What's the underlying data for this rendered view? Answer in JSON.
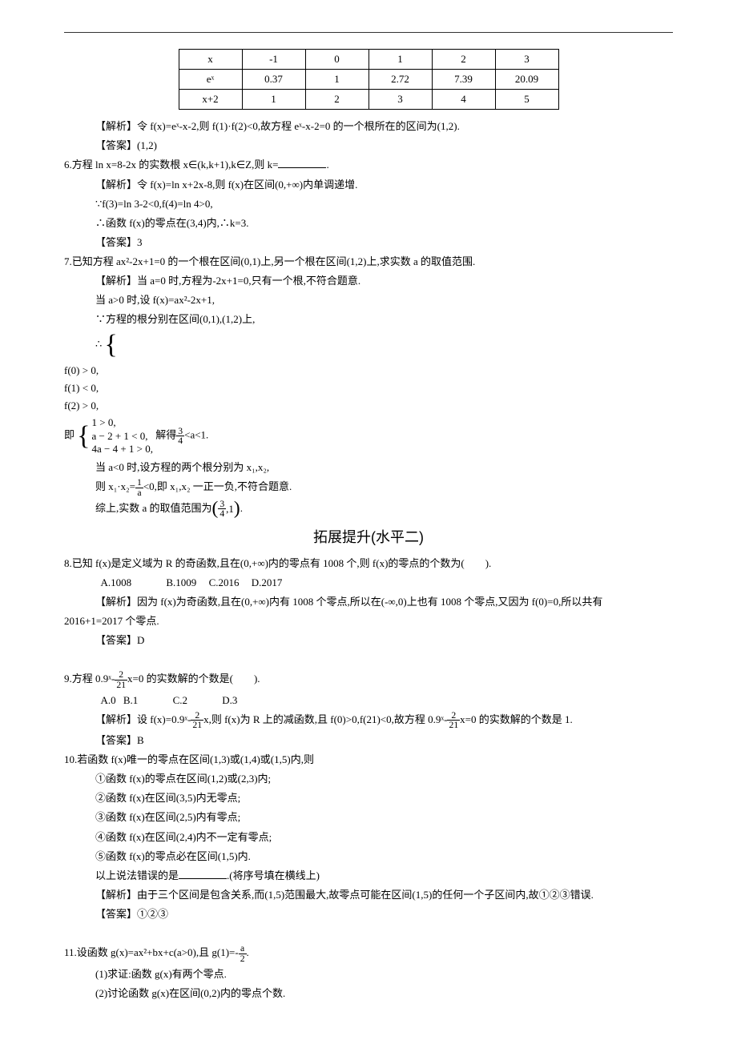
{
  "table": {
    "rows": [
      {
        "label": "x",
        "vals": [
          "-1",
          "0",
          "1",
          "2",
          "3"
        ]
      },
      {
        "label": "eˣ",
        "vals": [
          "0.37",
          "1",
          "2.72",
          "7.39",
          "20.09"
        ]
      },
      {
        "label": "x+2",
        "vals": [
          "1",
          "2",
          "3",
          "4",
          "5"
        ]
      }
    ]
  },
  "q5": {
    "analysis": "【解析】令 f(x)=eˣ-x-2,则 f(1)·f(2)<0,故方程 eˣ-x-2=0 的一个根所在的区间为(1,2).",
    "answer": "【答案】(1,2)"
  },
  "q6": {
    "stem": "6.方程 ln x=8-2x 的实数根 x∈(k,k+1),k∈Z,则 k=",
    "stem_tail": ".",
    "analysis1": "【解析】令 f(x)=ln x+2x-8,则 f(x)在区间(0,+∞)内单调递增.",
    "analysis2": "∵f(3)=ln 3-2<0,f(4)=ln 4>0,",
    "analysis3": "∴函数 f(x)的零点在(3,4)内,∴k=3.",
    "answer": "【答案】3"
  },
  "q7": {
    "stem": "7.已知方程 ax²-2x+1=0 的一个根在区间(0,1)上,另一个根在区间(1,2)上,求实数 a 的取值范围.",
    "l1": "【解析】当 a=0 时,方程为-2x+1=0,只有一个根,不符合题意.",
    "l2": "当 a>0 时,设 f(x)=ax²-2x+1,",
    "l3": "∵方程的根分别在区间(0,1),(1,2)上,",
    "brace_lead": "∴",
    "brace1_a": "f(0) > 0,",
    "brace1_b": "f(1) < 0,",
    "brace1_c": "f(2) > 0,",
    "brace_mid": "即",
    "brace2_a": "1 > 0,",
    "brace2_b": "a − 2 + 1 < 0,",
    "brace2_c": "4a − 4 + 1 > 0,",
    "brace_tail1": " 解得",
    "frac34_num": "3",
    "frac34_den": "4",
    "brace_tail2": "<a<1.",
    "l5": "当 a<0 时,设方程的两个根分别为 x₁,x₂,",
    "l6a": "则 x₁·x₂=",
    "frac1a_num": "1",
    "frac1a_den": "a",
    "l6b": "<0,即 x₁,x₂ 一正一负,不符合题意.",
    "l7a": "综上,实数 a 的取值范围为",
    "l7b": ",1",
    "l7c": "."
  },
  "section2": "拓展提升(水平二)",
  "q8": {
    "stem": "8.已知 f(x)是定义域为 R 的奇函数,且在(0,+∞)内的零点有 1008 个,则 f(x)的零点的个数为(　　).",
    "optA": "A.1008",
    "optB": "B.1009",
    "optC": "C.2016",
    "optD": "D.2017",
    "analysis1": "【解析】因为 f(x)为奇函数,且在(0,+∞)内有 1008 个零点,所以在(-∞,0)上也有 1008 个零点,又因为 f(0)=0,所以共有",
    "analysis2": "2016+1=2017 个零点.",
    "answer": "【答案】D"
  },
  "q9": {
    "stem_a": "9.方程 0.9ˣ-",
    "frac221_num": "2",
    "frac221_den": "21",
    "stem_b": "x=0 的实数解的个数是(　　).",
    "optA": "A.0",
    "optB": "B.1",
    "optC": "C.2",
    "optD": "D.3",
    "analysis_a": "【解析】设 f(x)=0.9ˣ-",
    "analysis_b": "x,则 f(x)为 R 上的减函数,且 f(0)>0,f(21)<0,故方程 0.9ˣ-",
    "analysis_c": "x=0 的实数解的个数是 1.",
    "answer": "【答案】B"
  },
  "q10": {
    "stem": "10.若函数 f(x)唯一的零点在区间(1,3)或(1,4)或(1,5)内,则",
    "s1": "①函数 f(x)的零点在区间(1,2)或(2,3)内;",
    "s2": "②函数 f(x)在区间(3,5)内无零点;",
    "s3": "③函数 f(x)在区间(2,5)内有零点;",
    "s4": "④函数 f(x)在区间(2,4)内不一定有零点;",
    "s5": "⑤函数 f(x)的零点必在区间(1,5)内.",
    "tail_a": "以上说法错误的是",
    "tail_b": ".(将序号填在横线上)",
    "analysis": "【解析】由于三个区间是包含关系,而(1,5)范围最大,故零点可能在区间(1,5)的任何一个子区间内,故①②③错误.",
    "answer": "【答案】①②③"
  },
  "q11": {
    "stem_a": "11.设函数 g(x)=ax²+bx+c(a>0),且 g(1)=-",
    "fraca2_num": "a",
    "fraca2_den": "2",
    "stem_b": ".",
    "p1": "(1)求证:函数 g(x)有两个零点.",
    "p2": "(2)讨论函数 g(x)在区间(0,2)内的零点个数."
  }
}
